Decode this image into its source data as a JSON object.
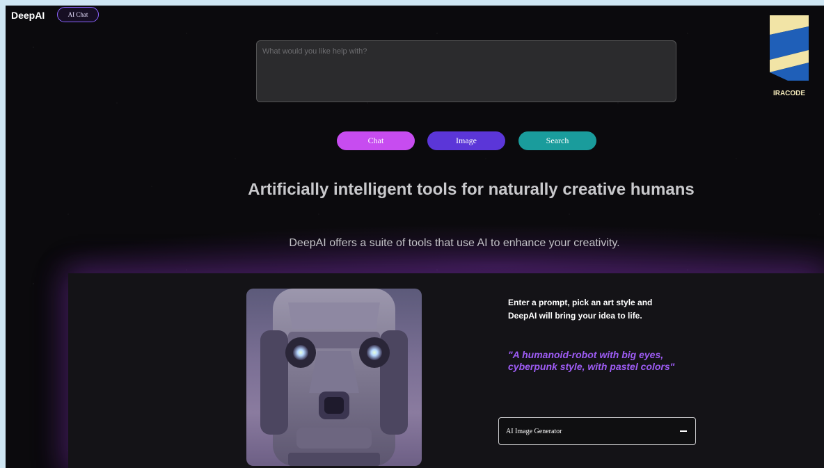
{
  "header": {
    "brand": "DeepAI",
    "chat_pill": "AI Chat"
  },
  "prompt": {
    "placeholder": "What would you like help with?",
    "value": ""
  },
  "mode_buttons": [
    {
      "label": "Chat",
      "color": "#c74cf0"
    },
    {
      "label": "Image",
      "color": "#5b36d8"
    },
    {
      "label": "Search",
      "color": "#1a9c9c"
    }
  ],
  "hero": {
    "headline": "Artificially intelligent tools for naturally creative humans",
    "subline": "DeepAI offers a suite of tools that use AI to enhance your creativity."
  },
  "feature": {
    "description": "Enter a prompt, pick an art style and DeepAI will bring your idea to life.",
    "example_prompt": "\"A humanoid-robot with big eyes, cyberpunk style, with pastel colors\"",
    "tool_select": {
      "selected": "AI Image Generator",
      "icon": "minus-icon"
    },
    "image_icon": "robot-face-image"
  },
  "watermark": {
    "text": "IRACODE",
    "icon": "iracode-logo-icon"
  },
  "colors": {
    "accent": "#9e5cf5",
    "background": "#0b0a0d"
  }
}
